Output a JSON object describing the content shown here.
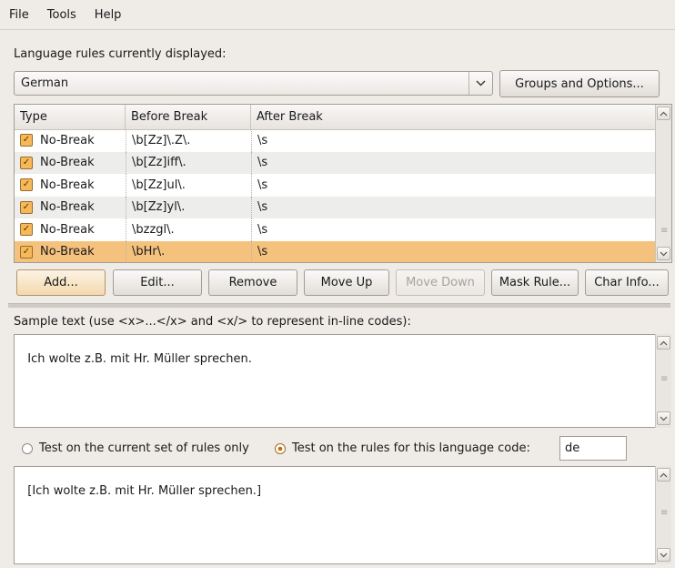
{
  "menu": {
    "file": "File",
    "tools": "Tools",
    "help": "Help"
  },
  "rules_label": "Language rules currently displayed:",
  "language_select": {
    "value": "German"
  },
  "groups_button": "Groups and Options...",
  "table": {
    "headers": [
      "Type",
      "Before Break",
      "After Break"
    ],
    "rows": [
      {
        "type": "No-Break",
        "before": "\\b[Zz]\\.Z\\.",
        "after": "\\s"
      },
      {
        "type": "No-Break",
        "before": "\\b[Zz]iff\\.",
        "after": "\\s"
      },
      {
        "type": "No-Break",
        "before": "\\b[Zz]ul\\.",
        "after": "\\s"
      },
      {
        "type": "No-Break",
        "before": "\\b[Zz]yl\\.",
        "after": "\\s"
      },
      {
        "type": "No-Break",
        "before": "\\bzzgl\\.",
        "after": "\\s"
      },
      {
        "type": "No-Break",
        "before": "\\bHr\\.",
        "after": "\\s"
      }
    ]
  },
  "buttons": {
    "add": "Add...",
    "edit": "Edit...",
    "remove": "Remove",
    "move_up": "Move Up",
    "move_down": "Move Down",
    "mask_rule": "Mask Rule...",
    "char_info": "Char Info..."
  },
  "sample_label": "Sample text (use <x>...</x> and <x/> to represent in-line codes):",
  "sample_text": "Ich wolte z.B. mit Hr. Müller sprechen.",
  "radio_current": "Test on the current set of rules only",
  "radio_language": "Test on the rules for this language code:",
  "language_code": "de",
  "result_text": "[Ich wolte z.B. mit Hr. Müller sprechen.]"
}
